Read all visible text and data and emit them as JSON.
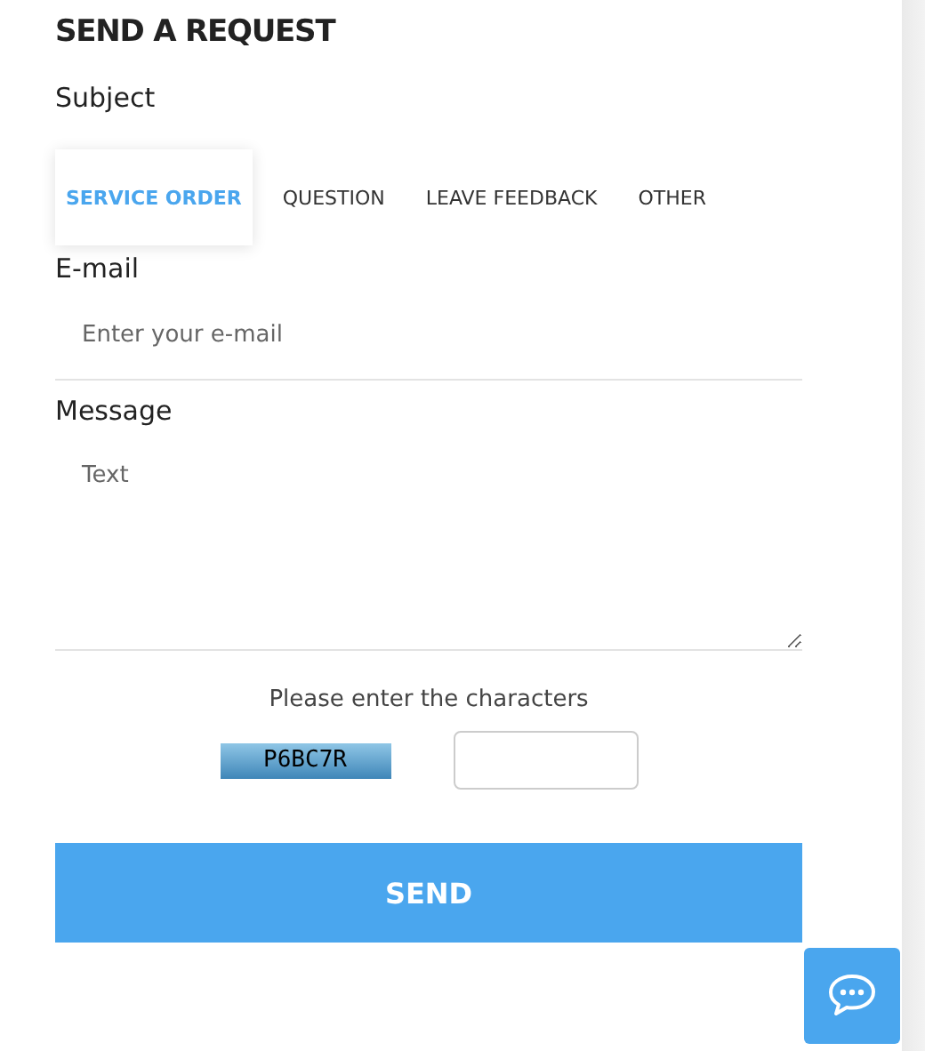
{
  "title": "SEND A REQUEST",
  "subject": {
    "label": "Subject",
    "tabs": [
      {
        "label": "SERVICE ORDER",
        "selected": true
      },
      {
        "label": "QUESTION",
        "selected": false
      },
      {
        "label": "LEAVE FEEDBACK",
        "selected": false
      },
      {
        "label": "OTHER",
        "selected": false
      }
    ]
  },
  "email": {
    "label": "E-mail",
    "placeholder": "Enter your e-mail"
  },
  "message": {
    "label": "Message",
    "placeholder": "Text"
  },
  "captcha": {
    "prompt": "Please enter the characters",
    "code": "P6BC7R"
  },
  "send_button": "SEND"
}
